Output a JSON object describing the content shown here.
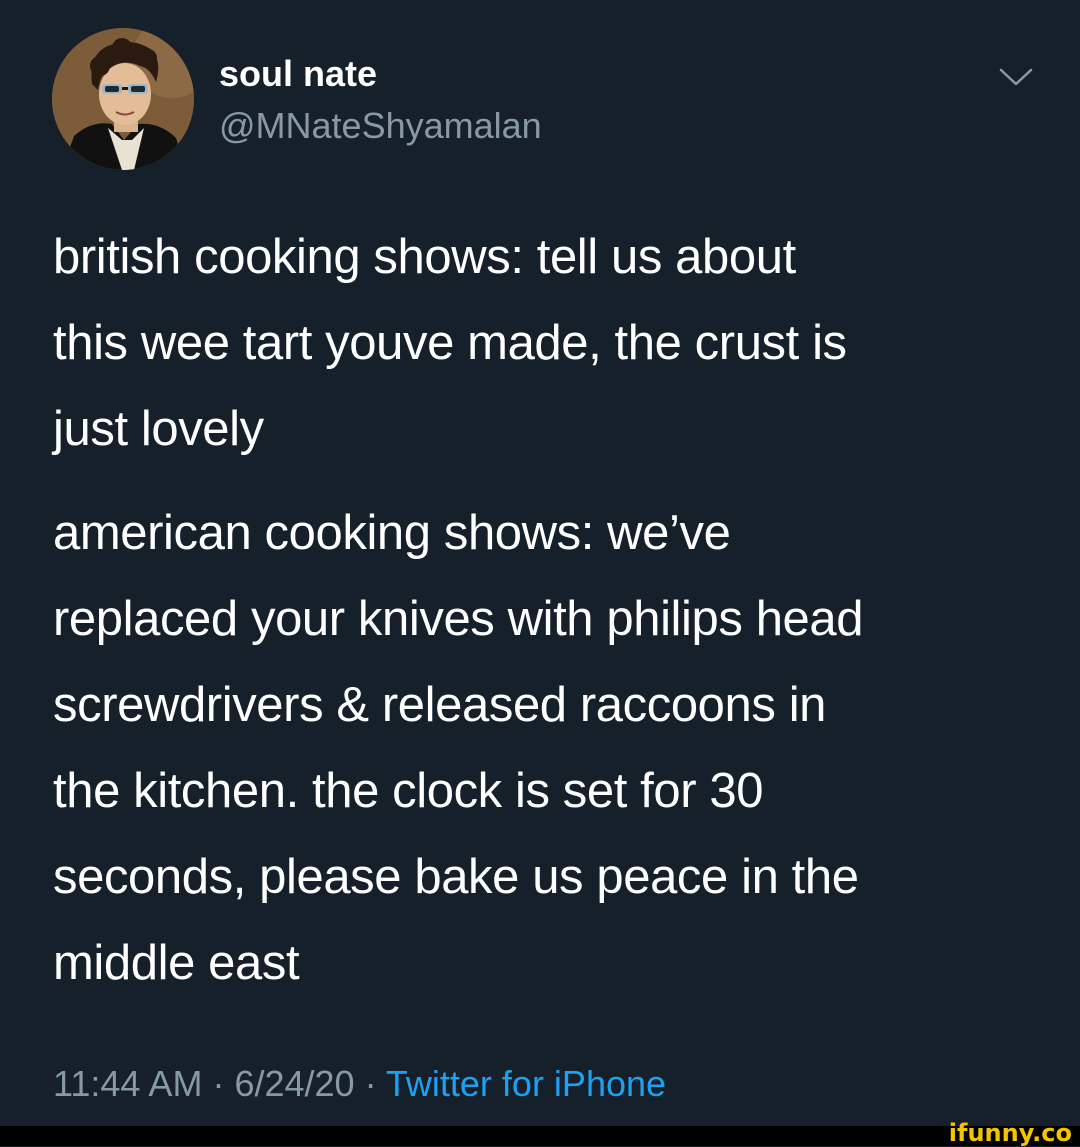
{
  "tweet": {
    "display_name": "soul nate",
    "handle": "@MNateShyamalan",
    "paragraphs": [
      "british cooking shows: tell us about\nthis wee tart youve made, the crust is\njust lovely",
      "american cooking shows: we’ve\nreplaced your knives with philips head\nscrewdrivers & released raccoons in\nthe kitchen. the clock is set for 30\nseconds, please bake us peace in the\nmiddle east"
    ],
    "time": "11:44 AM",
    "date": "6/24/20",
    "separator": " · ",
    "source": "Twitter for iPhone",
    "menu_icon": "chevron-down-icon",
    "avatar_icon": "portrait-avatar-icon"
  },
  "watermark": "ifunny.co",
  "colors": {
    "background": "#15202b",
    "text": "#ffffff",
    "secondary_text": "#8899a6",
    "link": "#1da1f2",
    "watermark": "#f5c400"
  }
}
